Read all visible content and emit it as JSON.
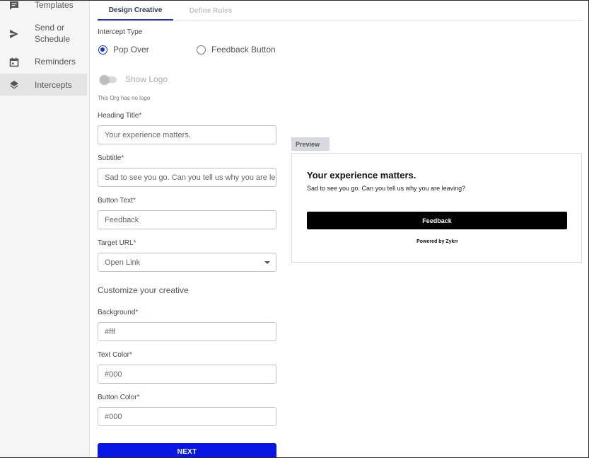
{
  "sidebar": {
    "items": [
      {
        "label": "Templates",
        "icon": "message-icon"
      },
      {
        "label": "Send or\nSchedule",
        "icon": "send-icon"
      },
      {
        "label": "Reminders",
        "icon": "calendar-icon"
      },
      {
        "label": "Intercepts",
        "icon": "layers-icon",
        "active": true
      }
    ]
  },
  "tabs": [
    {
      "label": "Design Creative",
      "active": true
    },
    {
      "label": "Define Rules",
      "active": false
    }
  ],
  "form": {
    "intercept_type_label": "Intercept Type",
    "intercept_options": [
      {
        "label": "Pop Over",
        "selected": true
      },
      {
        "label": "Feedback Button",
        "selected": false
      }
    ],
    "show_logo_label": "Show Logo",
    "show_logo_enabled": false,
    "no_logo_note": "This Org has no logo",
    "heading_title": {
      "label": "Heading Title",
      "value": "Your experience matters."
    },
    "subtitle": {
      "label": "Subtitle",
      "value": "Sad to see you go. Can you tell us why you are leaving?"
    },
    "button_text": {
      "label": "Button Text",
      "value": "Feedback"
    },
    "target_url": {
      "label": "Target URL",
      "value": "Open Link"
    },
    "customize_title": "Customize your creative",
    "background": {
      "label": "Background",
      "value": "#fff"
    },
    "text_color": {
      "label": "Text Color",
      "value": "#000"
    },
    "button_color": {
      "label": "Button Color",
      "value": "#000"
    },
    "required_mark": "*",
    "next_label": "NEXT"
  },
  "preview": {
    "tag": "Preview",
    "heading": "Your experience matters.",
    "subtitle": "Sad to see you go. Can you tell us why you are leaving?",
    "button": "Feedback",
    "powered_by": "Powered by Zykrr"
  },
  "colors": {
    "accent": "#1b2fd6",
    "next_button": "#0a16e6",
    "required": "#d32f2f"
  }
}
